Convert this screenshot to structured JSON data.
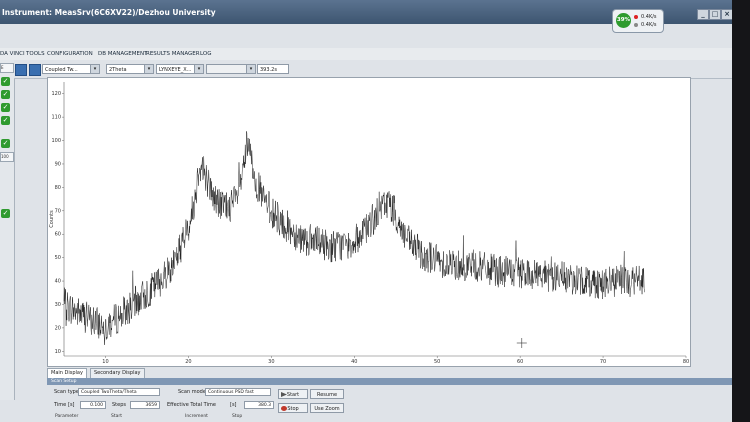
{
  "window": {
    "title": "Instrument: MeasSrv(6C6XV22)/Dezhou University",
    "controls": [
      "_",
      "□",
      "×"
    ]
  },
  "status": {
    "percent": "39%",
    "rate1": "0.4K/s",
    "rate2": "0.4K/s",
    "dot1_color": "#d22",
    "dot2_color": "#888"
  },
  "menu": [
    "DA VINCI",
    "TOOLS",
    "CONFIGURATION",
    "DB MANAGEMENT",
    "RESULTS MANAGER",
    "LOG"
  ],
  "toolbar": {
    "scan_type": "Coupled Tw...",
    "axis": "2Theta",
    "detector": "LYNXEYE_X...",
    "empty": "",
    "time": "393.2s"
  },
  "left_panel": {
    "btn1": "E",
    "btn2": "100"
  },
  "chart_data": {
    "type": "line",
    "ylabel": "Counts",
    "xlim": [
      5,
      80
    ],
    "ylim": [
      8,
      125
    ],
    "x_ticks": [
      10,
      20,
      30,
      40,
      50,
      60,
      70,
      80
    ],
    "y_ticks": [
      10,
      20,
      30,
      40,
      50,
      60,
      70,
      80,
      90,
      100,
      110,
      120
    ],
    "grid": false,
    "color": "#111111",
    "noise_amplitude": 7,
    "baseline_points": [
      [
        5,
        30
      ],
      [
        6,
        28
      ],
      [
        7,
        26
      ],
      [
        8,
        24
      ],
      [
        9,
        22
      ],
      [
        10,
        21
      ],
      [
        11,
        23
      ],
      [
        12,
        26
      ],
      [
        13,
        29
      ],
      [
        14,
        32
      ],
      [
        15,
        35
      ],
      [
        16,
        38
      ],
      [
        17,
        42
      ],
      [
        18,
        47
      ],
      [
        19,
        54
      ],
      [
        20,
        63
      ],
      [
        20.8,
        75
      ],
      [
        21.3,
        90
      ],
      [
        21.8,
        88
      ],
      [
        22.4,
        82
      ],
      [
        23,
        76
      ],
      [
        24,
        72
      ],
      [
        25,
        72
      ],
      [
        25.8,
        75
      ],
      [
        26.5,
        85
      ],
      [
        27,
        97
      ],
      [
        27.4,
        95
      ],
      [
        28,
        84
      ],
      [
        29,
        75
      ],
      [
        30,
        70
      ],
      [
        31,
        66
      ],
      [
        32,
        63
      ],
      [
        33,
        60
      ],
      [
        34,
        58
      ],
      [
        35,
        57
      ],
      [
        36,
        56
      ],
      [
        37,
        55
      ],
      [
        38,
        55
      ],
      [
        39,
        56
      ],
      [
        40,
        57
      ],
      [
        41,
        60
      ],
      [
        42,
        65
      ],
      [
        43,
        70
      ],
      [
        44,
        74
      ],
      [
        44.8,
        70
      ],
      [
        45.5,
        63
      ],
      [
        46.5,
        57
      ],
      [
        48,
        52
      ],
      [
        50,
        49
      ],
      [
        52,
        47
      ],
      [
        54,
        47
      ],
      [
        56,
        45
      ],
      [
        58,
        44
      ],
      [
        60,
        43
      ],
      [
        62,
        43
      ],
      [
        64,
        42
      ],
      [
        66,
        41
      ],
      [
        68,
        40
      ],
      [
        70,
        39
      ],
      [
        72,
        40
      ],
      [
        74,
        40
      ],
      [
        75,
        41
      ]
    ]
  },
  "tabs": [
    "Main Display",
    "Secondary Display"
  ],
  "scan_setup": {
    "header": "Scan Setup",
    "scan_type_label": "Scan type",
    "scan_type_value": "Coupled TwoTheta/Theta",
    "scan_mode_label": "Scan mode",
    "scan_mode_value": "Continuous PSD fast",
    "time_label": "Time",
    "time_unit": "[s]",
    "time_value": "0.100",
    "steps_label": "Steps",
    "steps_value": "3659",
    "eff_time_label": "Effective Total Time",
    "eff_time_unit": "[s]",
    "eff_time_value": "380.3",
    "start_button": "Start",
    "resume_button": "Resume",
    "stop_button": "Stop",
    "use_zoom_button": "Use Zoom",
    "footer_parameter": "Parameter",
    "footer_start": "Start",
    "footer_increment": "Increment",
    "footer_stop": "Stop"
  }
}
